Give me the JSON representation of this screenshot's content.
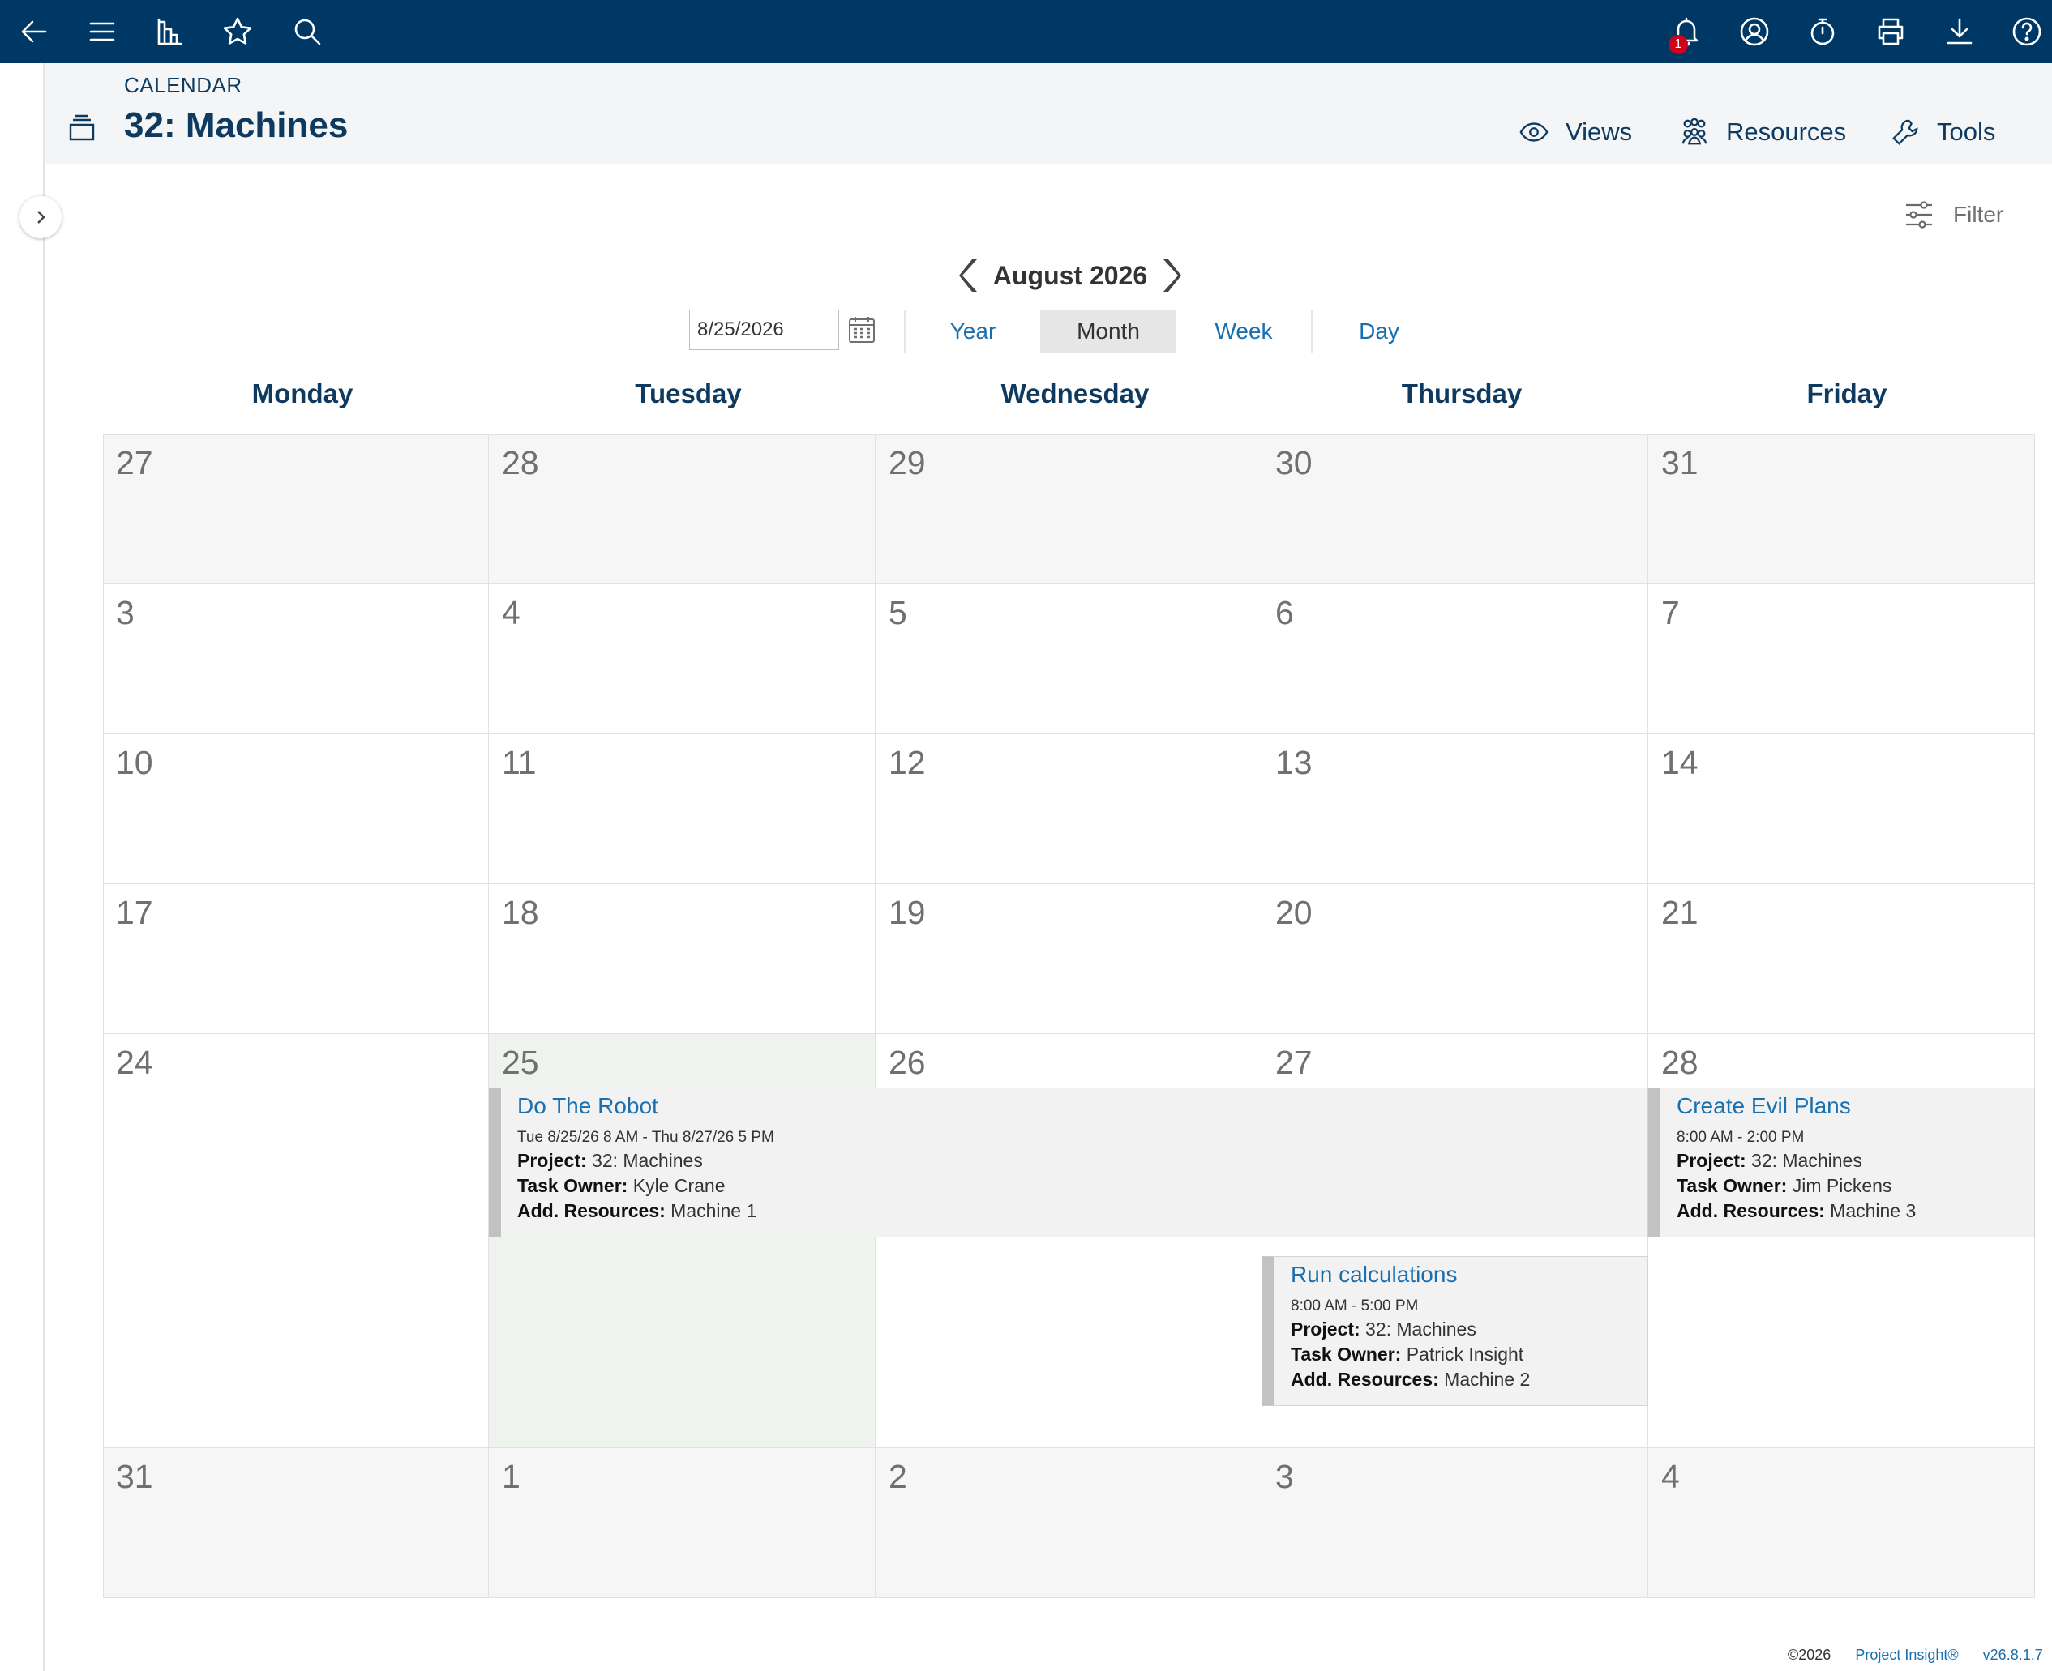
{
  "topbar": {
    "notification_count": "1"
  },
  "header": {
    "breadcrumb": "CALENDAR",
    "title": "32: Machines",
    "views_label": "Views",
    "resources_label": "Resources",
    "tools_label": "Tools"
  },
  "filter_label": "Filter",
  "calendar": {
    "month_label": "August 2026",
    "date_value": "8/25/2026",
    "view_tabs": [
      "Year",
      "Month",
      "Week",
      "Day"
    ],
    "active_view": "Month",
    "weekdays": [
      "Monday",
      "Tuesday",
      "Wednesday",
      "Thursday",
      "Friday"
    ],
    "weeks": [
      [
        "27",
        "28",
        "29",
        "30",
        "31"
      ],
      [
        "3",
        "4",
        "5",
        "6",
        "7"
      ],
      [
        "10",
        "11",
        "12",
        "13",
        "14"
      ],
      [
        "17",
        "18",
        "19",
        "20",
        "21"
      ],
      [
        "24",
        "25",
        "26",
        "27",
        "28"
      ],
      [
        "31",
        "1",
        "2",
        "3",
        "4"
      ]
    ],
    "today": "25",
    "events": [
      {
        "title": "Do The Robot",
        "time": "Tue 8/25/26 8 AM - Thu 8/27/26 5 PM",
        "project_label": "Project:",
        "project": "32: Machines",
        "owner_label": "Task Owner:",
        "owner": "Kyle Crane",
        "resources_label": "Add. Resources:",
        "resources": "Machine 1"
      },
      {
        "title": "Create Evil Plans",
        "time": "8:00 AM - 2:00 PM",
        "project_label": "Project:",
        "project": "32: Machines",
        "owner_label": "Task Owner:",
        "owner": "Jim Pickens",
        "resources_label": "Add. Resources:",
        "resources": "Machine 3"
      },
      {
        "title": "Run calculations",
        "time": "8:00 AM - 5:00 PM",
        "project_label": "Project:",
        "project": "32: Machines",
        "owner_label": "Task Owner:",
        "owner": "Patrick Insight",
        "resources_label": "Add. Resources:",
        "resources": "Machine 2"
      }
    ]
  },
  "footer": {
    "copyright": "©2026",
    "product": "Project Insight®",
    "version": "v26.8.1.7"
  },
  "colors": {
    "topbar": "#003865",
    "navy_text": "#0f3a5f",
    "link_blue": "#1a6fae",
    "badge_red": "#d0021b",
    "today_bg": "#eef3ee"
  }
}
